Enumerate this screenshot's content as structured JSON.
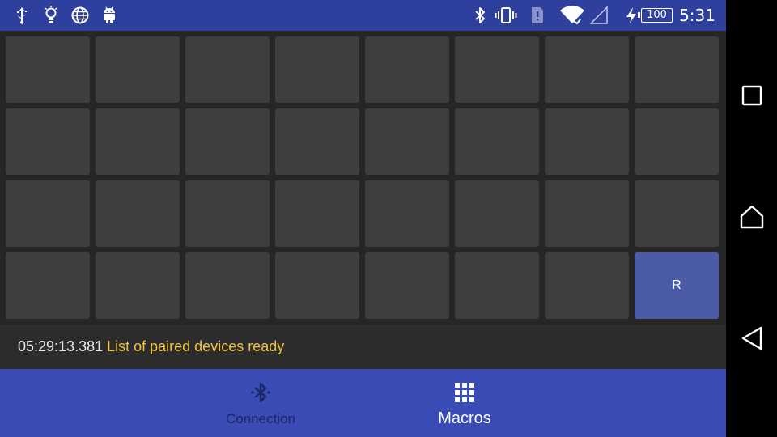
{
  "status_bar": {
    "left_icons": [
      "usb-icon",
      "lightbulb-icon",
      "globe-icon",
      "android-icon"
    ],
    "right_icons": [
      "bluetooth-icon",
      "vibrate-icon",
      "sim-icon",
      "wifi-icon",
      "cell-signal-icon",
      "charging-icon"
    ],
    "battery_level": "100",
    "time": "5:31",
    "background_color": "#2f3f9e"
  },
  "pad_grid": {
    "rows": 4,
    "columns": 8,
    "pads": [
      "",
      "",
      "",
      "",
      "",
      "",
      "",
      "",
      "",
      "",
      "",
      "",
      "",
      "",
      "",
      "",
      "",
      "",
      "",
      "",
      "",
      "",
      "",
      "",
      "",
      "",
      "",
      "",
      "",
      "",
      "",
      "R"
    ],
    "active_pad_index": 31,
    "pad_color": "#3e3e3e",
    "active_pad_color": "#4b5ba8"
  },
  "log": {
    "timestamp": "05:29:13.381",
    "message": "List of paired devices ready",
    "message_color": "#f2c23a"
  },
  "bottom_nav": {
    "tabs": [
      {
        "label": "Connection",
        "icon": "bluetooth-icon",
        "selected": false
      },
      {
        "label": "Macros",
        "icon": "grid-icon",
        "selected": true
      }
    ],
    "background_color": "#3a4bb5"
  },
  "system_nav": {
    "buttons": [
      "recents-square-icon",
      "home-icon",
      "back-triangle-icon"
    ]
  }
}
